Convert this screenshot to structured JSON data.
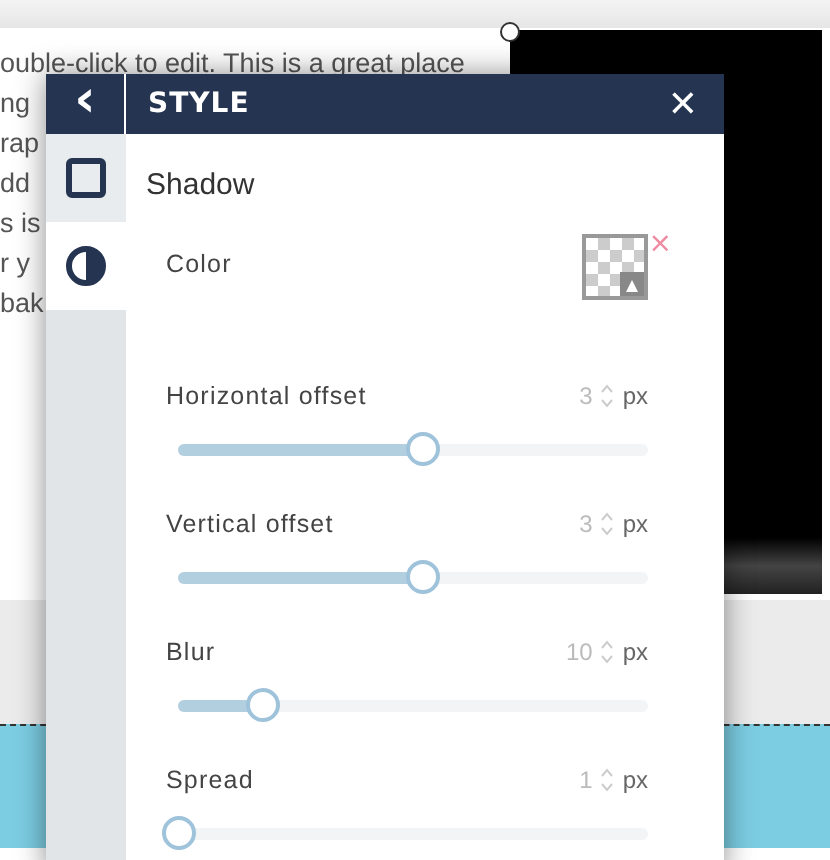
{
  "canvas": {
    "text_lines": [
      "ouble-click to edit. This is a great place",
      "ng",
      "rap",
      "dd",
      "s is",
      "r y",
      "bak"
    ]
  },
  "panel": {
    "title": "STYLE",
    "back": "‹",
    "close": "✕",
    "tabs": [
      {
        "kind": "square",
        "selected": false
      },
      {
        "kind": "contrast",
        "selected": true
      }
    ],
    "section": "Shadow",
    "color": {
      "label": "Color",
      "remove": "×"
    },
    "sliders": [
      {
        "label": "Horizontal offset",
        "value": "3",
        "unit": "px",
        "level": 0.52
      },
      {
        "label": "Vertical offset",
        "value": "3",
        "unit": "px",
        "level": 0.52
      },
      {
        "label": "Blur",
        "value": "10",
        "unit": "px",
        "level": 0.18
      },
      {
        "label": "Spread",
        "value": "1",
        "unit": "px",
        "level": 0
      }
    ]
  }
}
